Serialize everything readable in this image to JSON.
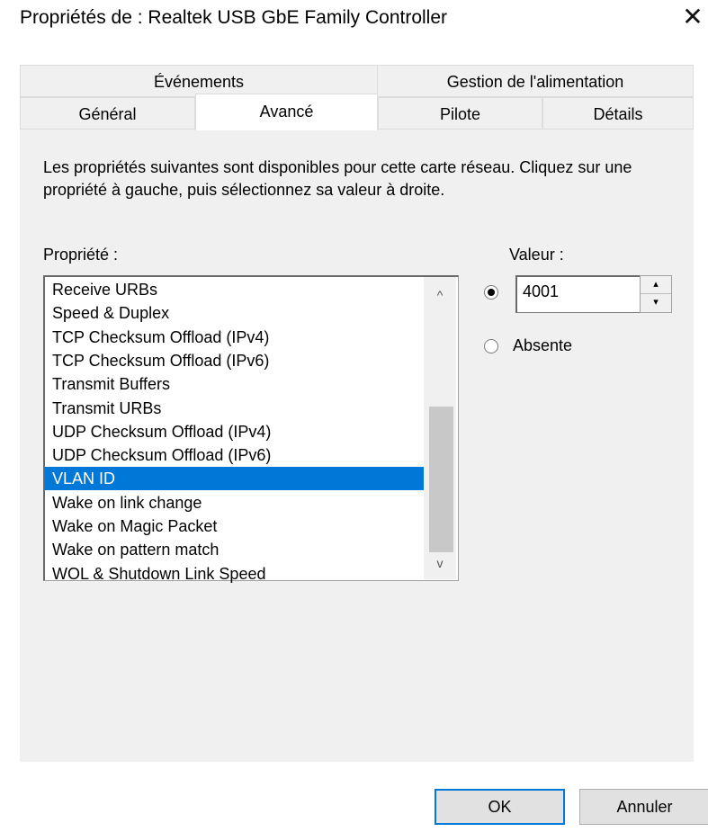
{
  "window": {
    "title": "Propriétés de : Realtek USB GbE Family Controller",
    "close_glyph": "✕"
  },
  "tabs": {
    "row1": [
      {
        "label": "Événements"
      },
      {
        "label": "Gestion de l'alimentation"
      }
    ],
    "row2": [
      {
        "label": "Général"
      },
      {
        "label": "Avancé",
        "active": true
      },
      {
        "label": "Pilote"
      },
      {
        "label": "Détails"
      }
    ]
  },
  "panel": {
    "description": "Les propriétés suivantes sont disponibles pour cette carte réseau. Cliquez sur une propriété à gauche, puis sélectionnez sa valeur à droite.",
    "property_label": "Propriété :",
    "value_label": "Valeur :",
    "properties": [
      "Receive URBs",
      "Speed & Duplex",
      "TCP Checksum Offload (IPv4)",
      "TCP Checksum Offload (IPv6)",
      "Transmit Buffers",
      "Transmit URBs",
      "UDP Checksum Offload (IPv4)",
      "UDP Checksum Offload (IPv6)",
      "VLAN ID",
      "Wake on link change",
      "Wake on Magic Packet",
      "Wake on pattern match",
      "WOL & Shutdown Link Speed"
    ],
    "selected_property": "VLAN ID",
    "value": "4001",
    "radio_value_selected": true,
    "absent_label": "Absente",
    "scroll_up_glyph": "^",
    "scroll_down_glyph": "v",
    "spin_up_glyph": "▴",
    "spin_down_glyph": "▾"
  },
  "buttons": {
    "ok": "OK",
    "cancel": "Annuler"
  },
  "colors": {
    "selection": "#0078d7",
    "panel_bg": "#f0f0f0"
  }
}
